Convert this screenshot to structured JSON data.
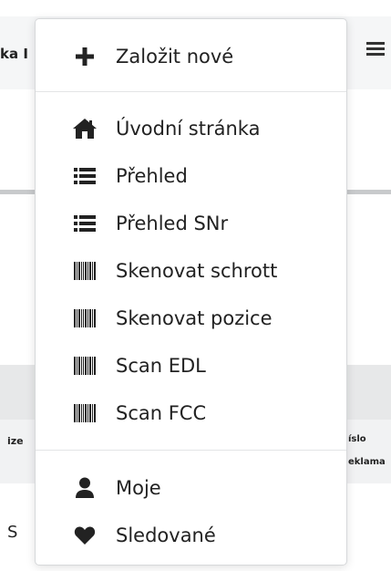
{
  "background": {
    "topbar_fragment": "ka I",
    "column_left": "ize",
    "column_right_line1": "íslo",
    "column_right_line2": "eklama",
    "cell_value": "S"
  },
  "menu": {
    "create": {
      "label": "Založit nové",
      "icon": "plus-icon"
    },
    "navigation": [
      {
        "label": "Úvodní stránka",
        "icon": "home-icon"
      },
      {
        "label": "Přehled",
        "icon": "list-icon"
      },
      {
        "label": "Přehled SNr",
        "icon": "list-icon"
      },
      {
        "label": "Skenovat schrott",
        "icon": "barcode-icon"
      },
      {
        "label": "Skenovat pozice",
        "icon": "barcode-icon"
      },
      {
        "label": "Scan EDL",
        "icon": "barcode-icon"
      },
      {
        "label": "Scan FCC",
        "icon": "barcode-icon"
      }
    ],
    "personal": [
      {
        "label": "Moje",
        "icon": "user-icon"
      },
      {
        "label": "Sledované",
        "icon": "heart-icon"
      }
    ]
  },
  "colors": {
    "text": "#222222",
    "menu_border": "#d6d8da",
    "divider": "#e3e4e6"
  }
}
